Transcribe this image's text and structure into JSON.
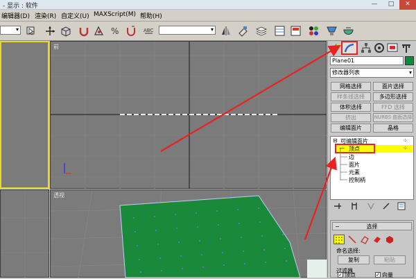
{
  "window": {
    "title": "- 显示 : 软件",
    "min": "—",
    "max": "□",
    "close": "✕"
  },
  "menubar": {
    "items": [
      "编辑器(D)",
      "渲染(R)",
      "自定义(U)",
      "MAXScript(M)",
      "帮助(H)"
    ]
  },
  "toolbar": {
    "dropdown_left": "▾",
    "dropdown_mid": "▾"
  },
  "viewports": {
    "top_right_label": "前",
    "bottom_right_label": "透视"
  },
  "panel": {
    "object_name": "Plane01",
    "object_color": "#0a8a3c",
    "modifier_list": "修改器列表",
    "buttons": [
      {
        "label": "网格选择",
        "enabled": true
      },
      {
        "label": "面片选择",
        "enabled": true
      },
      {
        "label": "样条线选择",
        "enabled": false
      },
      {
        "label": "多边形选择",
        "enabled": true
      },
      {
        "label": "体积选择",
        "enabled": true
      },
      {
        "label": "FFD 选择",
        "enabled": false
      },
      {
        "label": "挤出",
        "enabled": false
      },
      {
        "label": "NURBS 曲面选择",
        "enabled": false
      },
      {
        "label": "编辑面片",
        "enabled": true
      },
      {
        "label": "晶格",
        "enabled": true
      }
    ],
    "stack": {
      "root": "可编辑面片",
      "items": [
        "顶点",
        "边",
        "面片",
        "元素",
        "控制柄"
      ]
    },
    "rollout_title": "选择",
    "named_selection_label": "命名选择:",
    "copy_button": "复制",
    "paste_button": "粘贴",
    "filter_label": "过滤器",
    "filter_vertex": "顶点",
    "filter_vector": "向量"
  },
  "colors": {
    "highlight": "#ffff00",
    "annotation": "#e8221e",
    "plane": "#1a8a3a",
    "viewport_bg": "#7b7b7b"
  }
}
